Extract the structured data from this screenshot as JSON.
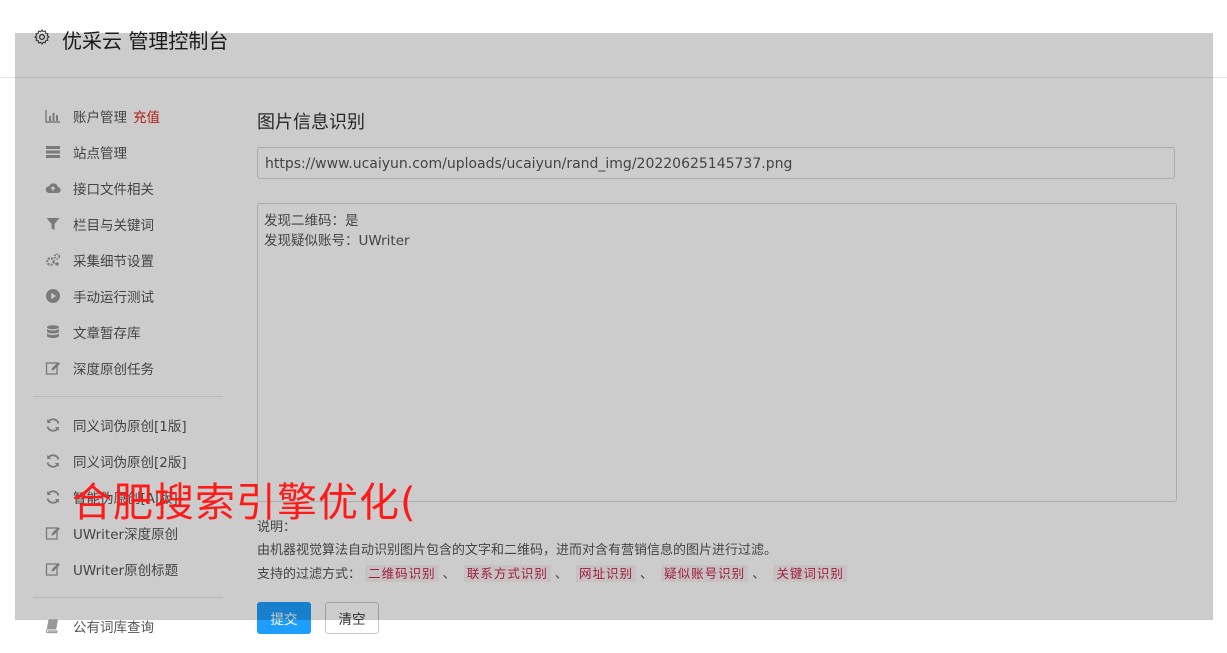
{
  "header": {
    "title": "优采云 管理控制台",
    "icon": "gear-icon"
  },
  "sidebar": {
    "group1": [
      {
        "icon": "bar-chart-icon",
        "label": "账户管理",
        "badge": "充值"
      },
      {
        "icon": "server-icon",
        "label": "站点管理"
      },
      {
        "icon": "cloud-upload-icon",
        "label": "接口文件相关"
      },
      {
        "icon": "filter-icon",
        "label": "栏目与关键词"
      },
      {
        "icon": "gears-icon",
        "label": "采集细节设置"
      },
      {
        "icon": "play-circle-icon",
        "label": "手动运行测试"
      },
      {
        "icon": "database-icon",
        "label": "文章暂存库"
      },
      {
        "icon": "edit-icon",
        "label": "深度原创任务"
      }
    ],
    "group2": [
      {
        "icon": "refresh-icon",
        "label": "同义词伪原创[1版]"
      },
      {
        "icon": "refresh-icon",
        "label": "同义词伪原创[2版]"
      },
      {
        "icon": "refresh-icon",
        "label": "智能伪原创[AI版]"
      },
      {
        "icon": "edit-icon",
        "label": "UWriter深度原创"
      },
      {
        "icon": "edit-icon",
        "label": "UWriter原创标题"
      }
    ],
    "group3": [
      {
        "icon": "book-icon",
        "label": "公有词库查询"
      }
    ]
  },
  "main": {
    "title": "图片信息识别",
    "url_value": "https://www.ucaiyun.com/uploads/ucaiyun/rand_img/20220625145737.png",
    "result_lines": [
      "发现二维码：是",
      "发现疑似账号：UWriter"
    ],
    "notes_label": "说明：",
    "notes_desc": "由机器视觉算法自动识别图片包含的文字和二维码，进而对含有营销信息的图片进行过滤。",
    "filter_label": "支持的过滤方式：",
    "filters": [
      "二维码识别",
      "联系方式识别",
      "网址识别",
      "疑似账号识别",
      "关键词识别"
    ],
    "filter_sep": "、",
    "submit_label": "提交",
    "clear_label": "清空"
  },
  "watermark": "合肥搜索引擎优化(",
  "colors": {
    "accent": "#1e9fff",
    "badge": "#e1251b",
    "tag": "#c7254e",
    "watermark": "#ff1a1a"
  }
}
